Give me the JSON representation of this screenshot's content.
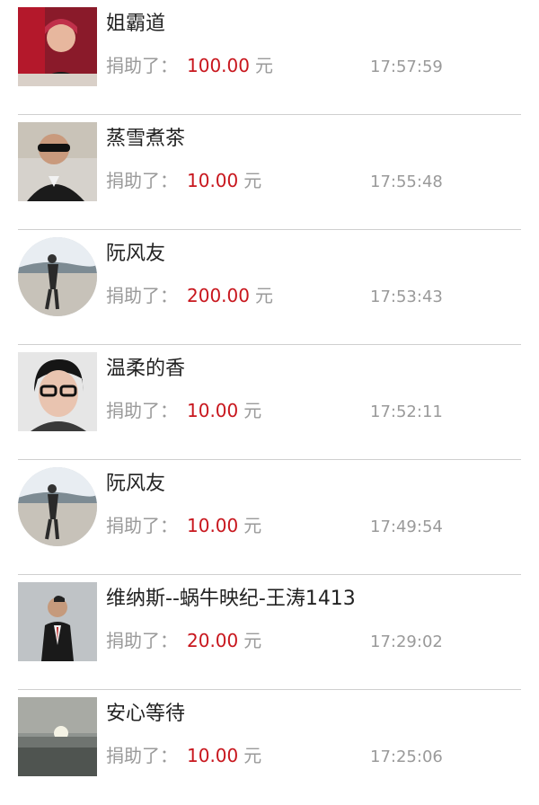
{
  "donations": {
    "label": "捐助了：",
    "unit": "元",
    "items": [
      {
        "name": "姐霸道",
        "amount": "100.00",
        "time": "17:57:59",
        "avatar_shape": "square"
      },
      {
        "name": "蒸雪煮茶",
        "amount": "10.00",
        "time": "17:55:48",
        "avatar_shape": "square"
      },
      {
        "name": "阮风友",
        "amount": "200.00",
        "time": "17:53:43",
        "avatar_shape": "round"
      },
      {
        "name": "温柔的香",
        "amount": "10.00",
        "time": "17:52:11",
        "avatar_shape": "square"
      },
      {
        "name": "阮风友",
        "amount": "10.00",
        "time": "17:49:54",
        "avatar_shape": "round"
      },
      {
        "name": "维纳斯--蜗牛映纪-王涛1413",
        "amount": "20.00",
        "time": "17:29:02",
        "avatar_shape": "square"
      },
      {
        "name": "安心等待",
        "amount": "10.00",
        "time": "17:25:06",
        "avatar_shape": "square"
      }
    ]
  },
  "colors": {
    "amount": "#c8161d",
    "secondary_text": "#9a9a9a",
    "divider": "#cfcfcf"
  }
}
